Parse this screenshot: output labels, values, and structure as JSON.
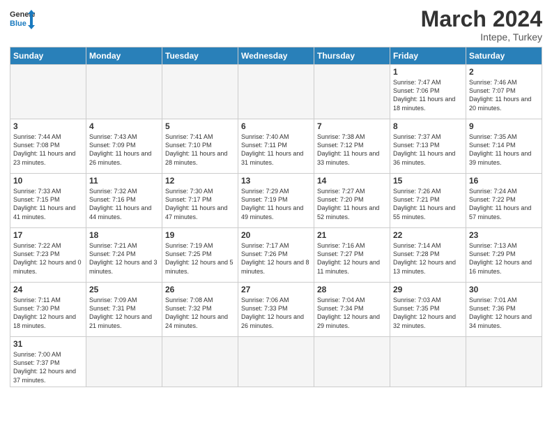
{
  "header": {
    "logo_general": "General",
    "logo_blue": "Blue",
    "month_title": "March 2024",
    "subtitle": "Intepe, Turkey"
  },
  "days_of_week": [
    "Sunday",
    "Monday",
    "Tuesday",
    "Wednesday",
    "Thursday",
    "Friday",
    "Saturday"
  ],
  "weeks": [
    [
      {
        "day": "",
        "info": ""
      },
      {
        "day": "",
        "info": ""
      },
      {
        "day": "",
        "info": ""
      },
      {
        "day": "",
        "info": ""
      },
      {
        "day": "",
        "info": ""
      },
      {
        "day": "1",
        "info": "Sunrise: 7:47 AM\nSunset: 7:06 PM\nDaylight: 11 hours\nand 18 minutes."
      },
      {
        "day": "2",
        "info": "Sunrise: 7:46 AM\nSunset: 7:07 PM\nDaylight: 11 hours\nand 20 minutes."
      }
    ],
    [
      {
        "day": "3",
        "info": "Sunrise: 7:44 AM\nSunset: 7:08 PM\nDaylight: 11 hours\nand 23 minutes."
      },
      {
        "day": "4",
        "info": "Sunrise: 7:43 AM\nSunset: 7:09 PM\nDaylight: 11 hours\nand 26 minutes."
      },
      {
        "day": "5",
        "info": "Sunrise: 7:41 AM\nSunset: 7:10 PM\nDaylight: 11 hours\nand 28 minutes."
      },
      {
        "day": "6",
        "info": "Sunrise: 7:40 AM\nSunset: 7:11 PM\nDaylight: 11 hours\nand 31 minutes."
      },
      {
        "day": "7",
        "info": "Sunrise: 7:38 AM\nSunset: 7:12 PM\nDaylight: 11 hours\nand 33 minutes."
      },
      {
        "day": "8",
        "info": "Sunrise: 7:37 AM\nSunset: 7:13 PM\nDaylight: 11 hours\nand 36 minutes."
      },
      {
        "day": "9",
        "info": "Sunrise: 7:35 AM\nSunset: 7:14 PM\nDaylight: 11 hours\nand 39 minutes."
      }
    ],
    [
      {
        "day": "10",
        "info": "Sunrise: 7:33 AM\nSunset: 7:15 PM\nDaylight: 11 hours\nand 41 minutes."
      },
      {
        "day": "11",
        "info": "Sunrise: 7:32 AM\nSunset: 7:16 PM\nDaylight: 11 hours\nand 44 minutes."
      },
      {
        "day": "12",
        "info": "Sunrise: 7:30 AM\nSunset: 7:17 PM\nDaylight: 11 hours\nand 47 minutes."
      },
      {
        "day": "13",
        "info": "Sunrise: 7:29 AM\nSunset: 7:19 PM\nDaylight: 11 hours\nand 49 minutes."
      },
      {
        "day": "14",
        "info": "Sunrise: 7:27 AM\nSunset: 7:20 PM\nDaylight: 11 hours\nand 52 minutes."
      },
      {
        "day": "15",
        "info": "Sunrise: 7:26 AM\nSunset: 7:21 PM\nDaylight: 11 hours\nand 55 minutes."
      },
      {
        "day": "16",
        "info": "Sunrise: 7:24 AM\nSunset: 7:22 PM\nDaylight: 11 hours\nand 57 minutes."
      }
    ],
    [
      {
        "day": "17",
        "info": "Sunrise: 7:22 AM\nSunset: 7:23 PM\nDaylight: 12 hours\nand 0 minutes."
      },
      {
        "day": "18",
        "info": "Sunrise: 7:21 AM\nSunset: 7:24 PM\nDaylight: 12 hours\nand 3 minutes."
      },
      {
        "day": "19",
        "info": "Sunrise: 7:19 AM\nSunset: 7:25 PM\nDaylight: 12 hours\nand 5 minutes."
      },
      {
        "day": "20",
        "info": "Sunrise: 7:17 AM\nSunset: 7:26 PM\nDaylight: 12 hours\nand 8 minutes."
      },
      {
        "day": "21",
        "info": "Sunrise: 7:16 AM\nSunset: 7:27 PM\nDaylight: 12 hours\nand 11 minutes."
      },
      {
        "day": "22",
        "info": "Sunrise: 7:14 AM\nSunset: 7:28 PM\nDaylight: 12 hours\nand 13 minutes."
      },
      {
        "day": "23",
        "info": "Sunrise: 7:13 AM\nSunset: 7:29 PM\nDaylight: 12 hours\nand 16 minutes."
      }
    ],
    [
      {
        "day": "24",
        "info": "Sunrise: 7:11 AM\nSunset: 7:30 PM\nDaylight: 12 hours\nand 18 minutes."
      },
      {
        "day": "25",
        "info": "Sunrise: 7:09 AM\nSunset: 7:31 PM\nDaylight: 12 hours\nand 21 minutes."
      },
      {
        "day": "26",
        "info": "Sunrise: 7:08 AM\nSunset: 7:32 PM\nDaylight: 12 hours\nand 24 minutes."
      },
      {
        "day": "27",
        "info": "Sunrise: 7:06 AM\nSunset: 7:33 PM\nDaylight: 12 hours\nand 26 minutes."
      },
      {
        "day": "28",
        "info": "Sunrise: 7:04 AM\nSunset: 7:34 PM\nDaylight: 12 hours\nand 29 minutes."
      },
      {
        "day": "29",
        "info": "Sunrise: 7:03 AM\nSunset: 7:35 PM\nDaylight: 12 hours\nand 32 minutes."
      },
      {
        "day": "30",
        "info": "Sunrise: 7:01 AM\nSunset: 7:36 PM\nDaylight: 12 hours\nand 34 minutes."
      }
    ],
    [
      {
        "day": "31",
        "info": "Sunrise: 7:00 AM\nSunset: 7:37 PM\nDaylight: 12 hours\nand 37 minutes."
      },
      {
        "day": "",
        "info": ""
      },
      {
        "day": "",
        "info": ""
      },
      {
        "day": "",
        "info": ""
      },
      {
        "day": "",
        "info": ""
      },
      {
        "day": "",
        "info": ""
      },
      {
        "day": "",
        "info": ""
      }
    ]
  ]
}
